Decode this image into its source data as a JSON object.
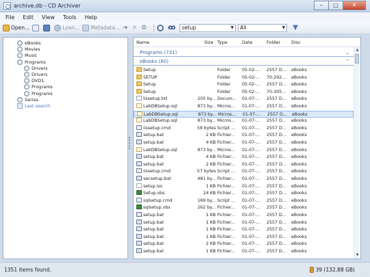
{
  "window": {
    "title": "archive.db - CD Archiver",
    "min": "–",
    "max": "□",
    "close": "✕"
  },
  "menu": [
    "File",
    "Edit",
    "View",
    "Tools",
    "Help"
  ],
  "toolbar": {
    "open": "Open...",
    "loan": "Loan...",
    "metadata": "Metadata...",
    "search_value": "setup",
    "scope_value": "All"
  },
  "tree": [
    {
      "label": "eBooks",
      "level": 0,
      "kind": "disc"
    },
    {
      "label": "Movies",
      "level": 0,
      "kind": "disc"
    },
    {
      "label": "Music",
      "level": 0,
      "kind": "disc"
    },
    {
      "label": "Programs",
      "level": 0,
      "kind": "disc"
    },
    {
      "label": "Drivers",
      "level": 1,
      "kind": "disc"
    },
    {
      "label": "Drivers",
      "level": 1,
      "kind": "disc"
    },
    {
      "label": "DVD1",
      "level": 1,
      "kind": "disc"
    },
    {
      "label": "Programs",
      "level": 1,
      "kind": "disc"
    },
    {
      "label": "Programs",
      "level": 1,
      "kind": "disc"
    },
    {
      "label": "Series",
      "level": 0,
      "kind": "disc"
    },
    {
      "label": "Last search",
      "level": 0,
      "kind": "search"
    }
  ],
  "columns": {
    "name": "Name",
    "size": "Size",
    "type": "Type",
    "date": "Date",
    "folder": "Folder",
    "disc": "Disc"
  },
  "groups": {
    "programs": "Programs (731)",
    "ebooks": "eBooks (60)"
  },
  "rows": [
    {
      "name": "Setup",
      "size": "",
      "type": "Folder",
      "date": "05-02-...",
      "folder": "2557 D...",
      "disc": "eBooks",
      "icon": "folder"
    },
    {
      "name": "SETUP",
      "size": "",
      "type": "Folder",
      "date": "05-02-...",
      "folder": "70-292...",
      "disc": "eBooks",
      "icon": "folder"
    },
    {
      "name": "Setup",
      "size": "",
      "type": "Folder",
      "date": "05-02-...",
      "folder": "2557 D...",
      "disc": "eBooks",
      "icon": "folder"
    },
    {
      "name": "Setup",
      "size": "",
      "type": "Folder",
      "date": "05-02-...",
      "folder": "70-305...",
      "disc": "eBooks",
      "icon": "folder"
    },
    {
      "name": "lissetup.txt",
      "size": "205 by...",
      "type": "Docum...",
      "date": "01-07-...",
      "folder": "2557 D...",
      "disc": "eBooks",
      "icon": "txt"
    },
    {
      "name": "LabDBSetup.sql",
      "size": "873 by...",
      "type": "Micros...",
      "date": "01-07-...",
      "folder": "2557 D...",
      "disc": "eBooks",
      "icon": "sql"
    },
    {
      "name": "LabDBSetup.sql",
      "size": "873 by...",
      "type": "Micros...",
      "date": "01-07-...",
      "folder": "2557 D...",
      "disc": "eBooks",
      "icon": "sql",
      "selected": true
    },
    {
      "name": "LabDBSetup.sql",
      "size": "873 by...",
      "type": "Micros...",
      "date": "01-07-...",
      "folder": "2557 D...",
      "disc": "eBooks",
      "icon": "sql"
    },
    {
      "name": "iissetup.cmd",
      "size": "59 bytes",
      "type": "Script ...",
      "date": "01-07-...",
      "folder": "2557 D...",
      "disc": "eBooks",
      "icon": "cmd"
    },
    {
      "name": "setup.bat",
      "size": "2 KB",
      "type": "Fichier...",
      "date": "01-07-...",
      "folder": "2557 D...",
      "disc": "eBooks",
      "icon": "bat"
    },
    {
      "name": "setup.bat",
      "size": "4 KB",
      "type": "Fichier...",
      "date": "01-07-...",
      "folder": "2557 D...",
      "disc": "eBooks",
      "icon": "bat"
    },
    {
      "name": "LabDBSetup.sql",
      "size": "873 by...",
      "type": "Micros...",
      "date": "01-07-...",
      "folder": "2557 D...",
      "disc": "eBooks",
      "icon": "sql"
    },
    {
      "name": "setup.bat",
      "size": "4 KB",
      "type": "Fichier...",
      "date": "01-07-...",
      "folder": "2557 D...",
      "disc": "eBooks",
      "icon": "bat"
    },
    {
      "name": "setup.bat",
      "size": "2 KB",
      "type": "Fichier...",
      "date": "01-07-...",
      "folder": "2557 D...",
      "disc": "eBooks",
      "icon": "bat"
    },
    {
      "name": "iissetup.cmd",
      "size": "57 bytes",
      "type": "Script ...",
      "date": "01-07-...",
      "folder": "2557 D...",
      "disc": "eBooks",
      "icon": "cmd"
    },
    {
      "name": "secsetup.bat",
      "size": "481 by...",
      "type": "Fichier...",
      "date": "01-07-...",
      "folder": "2557 D...",
      "disc": "eBooks",
      "icon": "bat"
    },
    {
      "name": "setup.iss",
      "size": "1 KB",
      "type": "Fichier...",
      "date": "01-07-...",
      "folder": "2557 D...",
      "disc": "eBooks",
      "icon": "iss"
    },
    {
      "name": "Setup.vbs",
      "size": "24 KB",
      "type": "Fichier...",
      "date": "01-07-...",
      "folder": "2557 D...",
      "disc": "eBooks",
      "icon": "vbs"
    },
    {
      "name": "sqlsetup.cmd",
      "size": "169 by...",
      "type": "Script ...",
      "date": "01-07-...",
      "folder": "2557 D...",
      "disc": "eBooks",
      "icon": "cmd"
    },
    {
      "name": "sqlsetup.vbs",
      "size": "262 by...",
      "type": "Fichier...",
      "date": "01-07-...",
      "folder": "2557 D...",
      "disc": "eBooks",
      "icon": "vbs"
    },
    {
      "name": "setup.bat",
      "size": "1 KB",
      "type": "Fichier...",
      "date": "01-07-...",
      "folder": "2557 D...",
      "disc": "eBooks",
      "icon": "bat"
    },
    {
      "name": "setup.bat",
      "size": "1 KB",
      "type": "Fichier...",
      "date": "01-07-...",
      "folder": "2557 D...",
      "disc": "eBooks",
      "icon": "bat"
    },
    {
      "name": "setup.bat",
      "size": "1 KB",
      "type": "Fichier...",
      "date": "01-07-...",
      "folder": "2557 D...",
      "disc": "eBooks",
      "icon": "bat"
    },
    {
      "name": "setup.bat",
      "size": "1 KB",
      "type": "Fichier...",
      "date": "01-07-...",
      "folder": "2557 D...",
      "disc": "eBooks",
      "icon": "bat"
    },
    {
      "name": "setup.bat",
      "size": "2 KB",
      "type": "Fichier...",
      "date": "01-07-...",
      "folder": "2557 D...",
      "disc": "eBooks",
      "icon": "bat"
    },
    {
      "name": "setup.bat",
      "size": "1 KB",
      "type": "Fichier...",
      "date": "01-07-...",
      "folder": "2557 D...",
      "disc": "eBooks",
      "icon": "bat"
    }
  ],
  "status": {
    "items_found": "1351 items found.",
    "discs": "39 (132,88 GB)"
  }
}
